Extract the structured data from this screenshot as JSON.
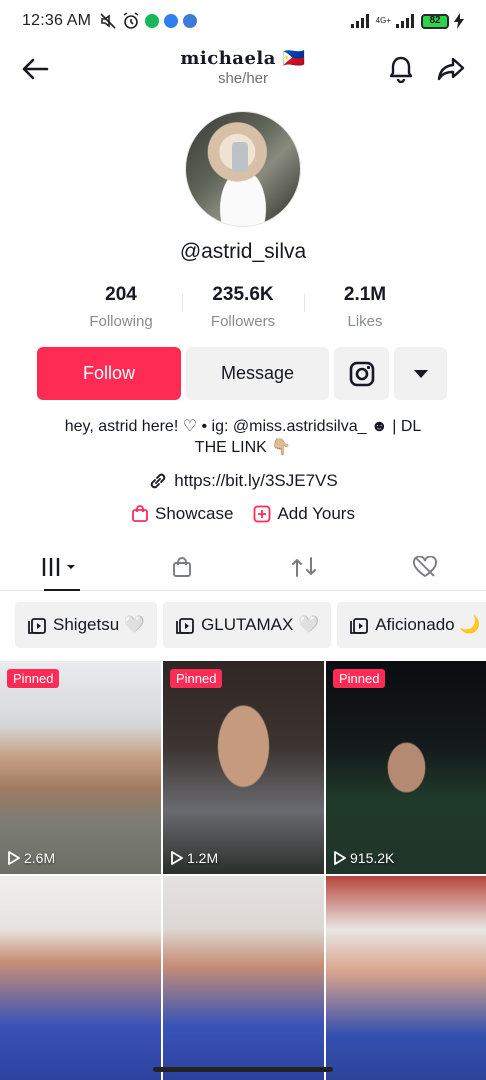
{
  "status_bar": {
    "time": "12:36 AM",
    "battery": "82",
    "network": "4G+"
  },
  "header": {
    "name": "michaela 🇵🇭",
    "pronouns": "she/her"
  },
  "profile": {
    "username": "@astrid_silva"
  },
  "stats": [
    {
      "value": "204",
      "label": "Following"
    },
    {
      "value": "235.6K",
      "label": "Followers"
    },
    {
      "value": "2.1M",
      "label": "Likes"
    }
  ],
  "actions": {
    "follow": "Follow",
    "message": "Message"
  },
  "bio": {
    "line1": "hey, astrid here! ♡ • ig: @miss.astridsilva_ ☻ | DL",
    "line2": "THE LINK 👇🏼"
  },
  "link": "https://bit.ly/3SJE7VS",
  "extras": {
    "showcase": "Showcase",
    "add_yours": "Add Yours"
  },
  "playlists": [
    {
      "label": "Shigetsu 🤍"
    },
    {
      "label": "GLUTAMAX 🤍"
    },
    {
      "label": "Aficionado 🌙"
    }
  ],
  "videos": [
    {
      "pinned": "Pinned",
      "views": "2.6M"
    },
    {
      "pinned": "Pinned",
      "views": "1.2M"
    },
    {
      "pinned": "Pinned",
      "views": "915.2K"
    },
    {
      "pinned": "",
      "views": ""
    },
    {
      "pinned": "",
      "views": ""
    },
    {
      "pinned": "",
      "views": ""
    }
  ],
  "colors": {
    "accent": "#fe2c55",
    "button_bg": "#f1f1f2",
    "battery": "#2fd34b"
  }
}
